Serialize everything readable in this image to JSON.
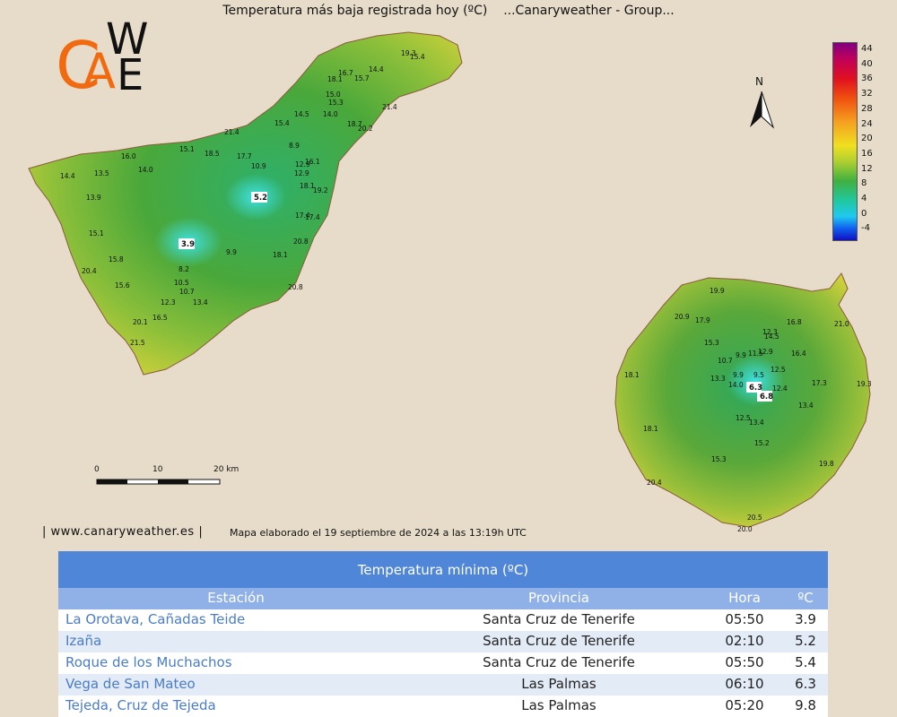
{
  "title": "Temperatura más baja registrada hoy (ºC)    ...Canaryweather - Group...",
  "logo": {
    "letters": "CAWE"
  },
  "north": "N",
  "legend": {
    "labels": [
      "44",
      "40",
      "36",
      "32",
      "28",
      "24",
      "20",
      "16",
      "12",
      "8",
      "4",
      "0",
      "-4"
    ]
  },
  "scale_bar": {
    "labels": [
      "0",
      "10",
      "20 km"
    ]
  },
  "footer": {
    "site": "| www.canaryweather.es |",
    "date": "Mapa elaborado el 19 septiembre de 2024 a las 13:19h UTC"
  },
  "tenerife_values": [
    {
      "t": "19.3"
    },
    {
      "t": "15.4"
    },
    {
      "t": "16.7"
    },
    {
      "t": "14.4"
    },
    {
      "t": "18.1"
    },
    {
      "t": "15.7"
    },
    {
      "t": "15.0"
    },
    {
      "t": "15.3"
    },
    {
      "t": "21.4"
    },
    {
      "t": "14.5"
    },
    {
      "t": "14.0"
    },
    {
      "t": "15.4"
    },
    {
      "t": "18.7"
    },
    {
      "t": "20.2"
    },
    {
      "t": "21.4"
    },
    {
      "t": "8.9"
    },
    {
      "t": "15.1"
    },
    {
      "t": "18.5"
    },
    {
      "t": "17.7"
    },
    {
      "t": "16.1"
    },
    {
      "t": "12.9"
    },
    {
      "t": "10.9"
    },
    {
      "t": "12.9"
    },
    {
      "t": "16.0"
    },
    {
      "t": "14.0"
    },
    {
      "t": "13.5"
    },
    {
      "t": "14.4"
    },
    {
      "t": "18.1"
    },
    {
      "t": "19.2"
    },
    {
      "t": "13.9"
    },
    {
      "t": "17.4"
    },
    {
      "t": "17.4"
    },
    {
      "t": "15.1"
    },
    {
      "t": "20.8"
    },
    {
      "t": "9.9"
    },
    {
      "t": "18.1"
    },
    {
      "t": "15.8"
    },
    {
      "t": "20.4"
    },
    {
      "t": "8.2"
    },
    {
      "t": "15.6"
    },
    {
      "t": "10.5"
    },
    {
      "t": "20.8"
    },
    {
      "t": "10.7"
    },
    {
      "t": "12.3"
    },
    {
      "t": "13.4"
    },
    {
      "t": "16.5"
    },
    {
      "t": "20.1"
    },
    {
      "t": "21.5"
    }
  ],
  "tenerife_boxed": [
    {
      "t": "5.2"
    },
    {
      "t": "3.9"
    }
  ],
  "grancanaria_values": [
    {
      "t": "19.9"
    },
    {
      "t": "20.9"
    },
    {
      "t": "17.9"
    },
    {
      "t": "21.0"
    },
    {
      "t": "16.8"
    },
    {
      "t": "12.3"
    },
    {
      "t": "14.5"
    },
    {
      "t": "15.3"
    },
    {
      "t": "12.9"
    },
    {
      "t": "11.5"
    },
    {
      "t": "9.9"
    },
    {
      "t": "16.4"
    },
    {
      "t": "10.7"
    },
    {
      "t": "12.5"
    },
    {
      "t": "18.1"
    },
    {
      "t": "13.3"
    },
    {
      "t": "9.9"
    },
    {
      "t": "9.5"
    },
    {
      "t": "14.0"
    },
    {
      "t": "17.3"
    },
    {
      "t": "19.3"
    },
    {
      "t": "12.4"
    },
    {
      "t": "13.4"
    },
    {
      "t": "12.5"
    },
    {
      "t": "13.4"
    },
    {
      "t": "18.1"
    },
    {
      "t": "15.2"
    },
    {
      "t": "15.3"
    },
    {
      "t": "19.8"
    },
    {
      "t": "20.4"
    },
    {
      "t": "20.5"
    },
    {
      "t": "20.0"
    }
  ],
  "grancanaria_boxed": [
    {
      "t": "6.3"
    },
    {
      "t": "6.8"
    }
  ],
  "table": {
    "title": "Temperatura mínima (ºC)",
    "headers": {
      "estacion": "Estación",
      "provincia": "Provincia",
      "hora": "Hora",
      "temp": "ºC"
    },
    "rows": [
      {
        "estacion": "La Orotava, Cañadas Teide",
        "provincia": "Santa Cruz de Tenerife",
        "hora": "05:50",
        "temp": "3.9"
      },
      {
        "estacion": "Izaña",
        "provincia": "Santa Cruz de Tenerife",
        "hora": "02:10",
        "temp": "5.2"
      },
      {
        "estacion": "Roque de los Muchachos",
        "provincia": "Santa Cruz de Tenerife",
        "hora": "05:50",
        "temp": "5.4"
      },
      {
        "estacion": "Vega de San Mateo",
        "provincia": "Las Palmas",
        "hora": "06:10",
        "temp": "6.3"
      },
      {
        "estacion": "Tejeda, Cruz de Tejeda",
        "provincia": "Las Palmas",
        "hora": "05:20",
        "temp": "9.8"
      }
    ]
  },
  "colors": {
    "background": "#e7dcc9",
    "table_title_bg": "#4f86d8",
    "table_header_bg": "#8fb1e8",
    "link": "#4a7cc8",
    "logo_orange": "#f26a10"
  }
}
